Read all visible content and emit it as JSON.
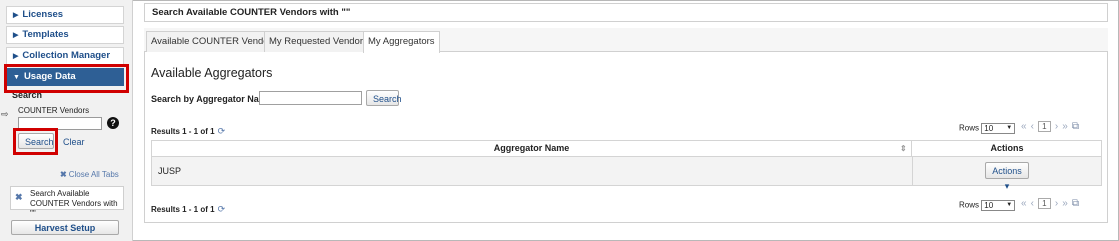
{
  "sidebar": {
    "items": [
      {
        "label": "Licenses"
      },
      {
        "label": "Templates"
      },
      {
        "label": "Collection Manager"
      },
      {
        "label": "Usage Data"
      }
    ],
    "search_heading": "Search",
    "counter_vendors_label": "COUNTER Vendors",
    "counter_vendors_value": "",
    "search_button": "Search",
    "clear_link": "Clear",
    "close_all_tabs": "Close All Tabs",
    "open_tab_label": "Search Available COUNTER Vendors with \"\"",
    "harvest_setup": "Harvest Setup"
  },
  "main": {
    "title": "Search Available COUNTER Vendors with \"\"",
    "tabs": [
      {
        "label": "Available COUNTER Vendors"
      },
      {
        "label": "My Requested Vendors"
      },
      {
        "label": "My Aggregators"
      }
    ],
    "section_title": "Available Aggregators",
    "search_by_label": "Search by Aggregator Name",
    "aggregator_name_value": "",
    "search_button": "Search",
    "results_text": "Results 1 - 1 of 1",
    "rows_label": "Rows",
    "rows_value": "10",
    "current_page": "1",
    "table": {
      "columns": [
        "Aggregator Name",
        "Actions"
      ],
      "rows": [
        {
          "name": "JUSP",
          "action": "Actions ▾"
        }
      ]
    }
  },
  "highlight_color": "#d00000",
  "accent_color": "#2e5f95"
}
